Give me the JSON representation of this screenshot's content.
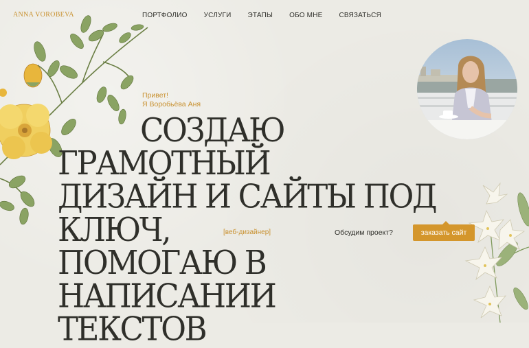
{
  "brand": {
    "logo": "ANNA VOROBEVA"
  },
  "nav": {
    "items": [
      {
        "label": "ПОРТФОЛИО"
      },
      {
        "label": "УСЛУГИ"
      },
      {
        "label": "ЭТАПЫ"
      },
      {
        "label": "ОБО МНЕ"
      },
      {
        "label": "СВЯЗАТЬСЯ"
      }
    ]
  },
  "hero": {
    "greeting_line1": "Привет!",
    "greeting_line2": "Я Воробьёва Аня",
    "headline_line1": "СОЗДАЮ ГРАМОТНЫЙ",
    "headline_line2": "ДИЗАЙН И САЙТЫ ПОД КЛЮЧ,",
    "headline_line3": "ПОМОГАЮ В НАПИСАНИИ",
    "headline_line4": "ТЕКСТОВ",
    "role_tag": "[веб-дизайнер]",
    "discuss_text": "Обсудим проект?",
    "cta_label": "заказать сайт"
  },
  "colors": {
    "background": "#ecebe5",
    "accent": "#d4962c",
    "text": "#2f2f2a",
    "leaf": "#7f9a5c",
    "flower": "#f0cf5f"
  },
  "icons": {
    "left_decoration": "yellow-rose-botanical",
    "right_decoration": "white-lily-botanical",
    "avatar": "portrait-photo"
  }
}
